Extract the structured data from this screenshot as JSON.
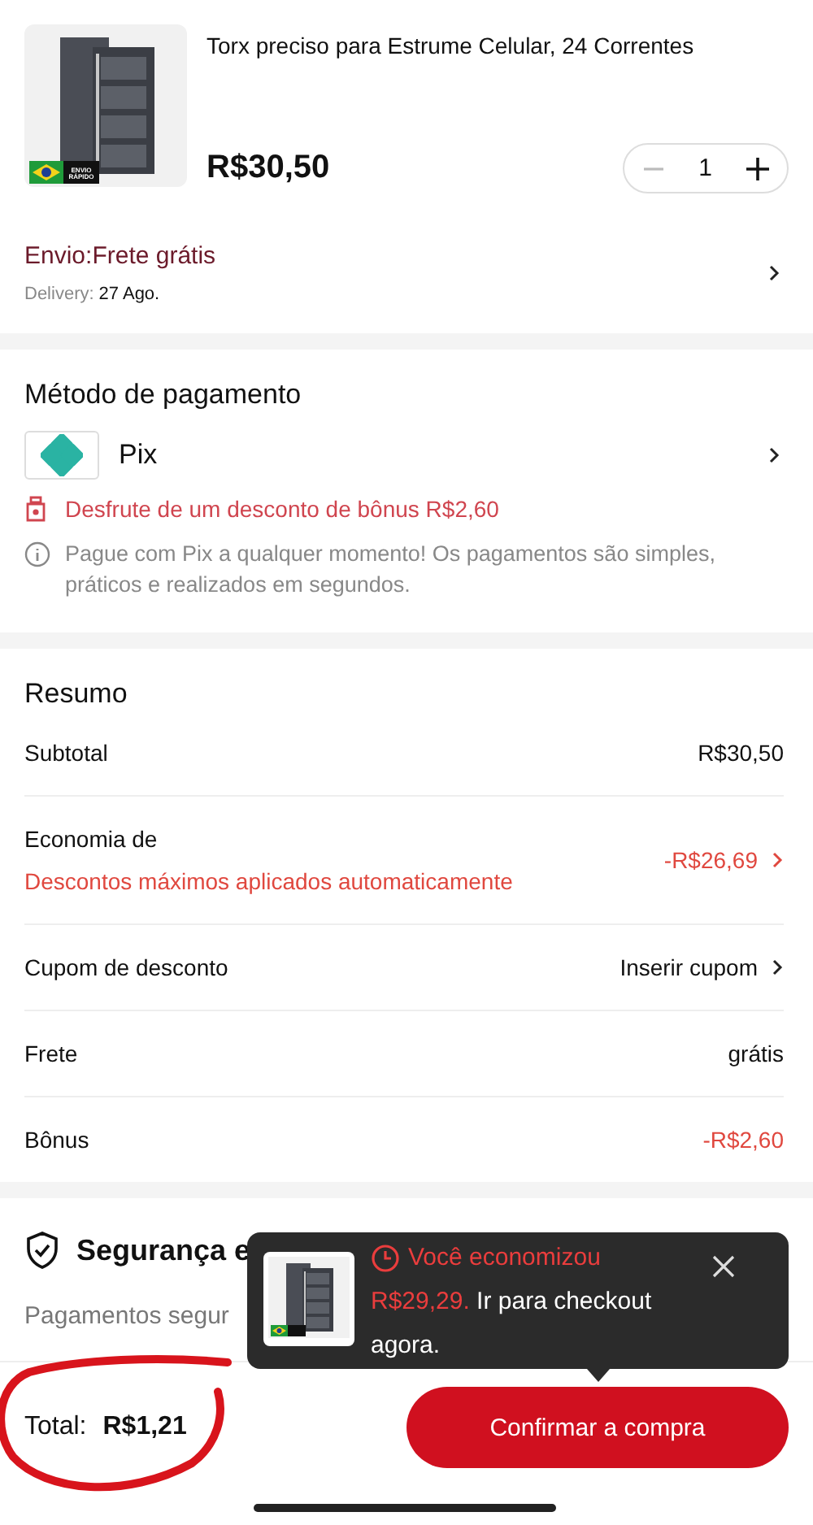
{
  "product": {
    "title": "Torx preciso para Estrume Celular, 24 Correntes",
    "price": "R$30,50",
    "quantity": "1",
    "badge": "ENVIO RÁPIDO"
  },
  "shipping": {
    "label": "Envio:Frete grátis",
    "delivery_label": "Delivery:",
    "delivery_date": "27 Ago."
  },
  "payment": {
    "heading": "Método de pagamento",
    "method": "Pix",
    "bonus": "Desfrute de um desconto de bônus R$2,60",
    "info": "Pague com Pix a qualquer momento! Os pagamentos são simples, práticos e realizados em segundos."
  },
  "summary": {
    "heading": "Resumo",
    "rows": [
      {
        "kind": "plain",
        "label": "Subtotal",
        "value": "R$30,50",
        "highlight": false,
        "chevron": false
      },
      {
        "kind": "savings",
        "label": "Economia de",
        "sublabel": "Descontos máximos aplicados automaticamente",
        "value": "-R$26,69",
        "highlight": true,
        "chevron": true
      },
      {
        "kind": "plain",
        "label": "Cupom de desconto",
        "value": "Inserir cupom",
        "highlight": false,
        "chevron": true
      },
      {
        "kind": "plain",
        "label": "Frete",
        "value": "grátis",
        "highlight": false,
        "chevron": false
      },
      {
        "kind": "plain",
        "label": "Bônus",
        "value": "-R$2,60",
        "highlight": true,
        "chevron": false
      }
    ]
  },
  "security": {
    "heading": "Segurança e",
    "text": "Pagamentos segur"
  },
  "tooltip": {
    "line_red": "Você economizou",
    "amount": "R$29,29.",
    "text": "Ir para checkout agora."
  },
  "footer": {
    "total_label": "Total:",
    "total": "R$1,21",
    "button": "Confirmar a compra"
  }
}
